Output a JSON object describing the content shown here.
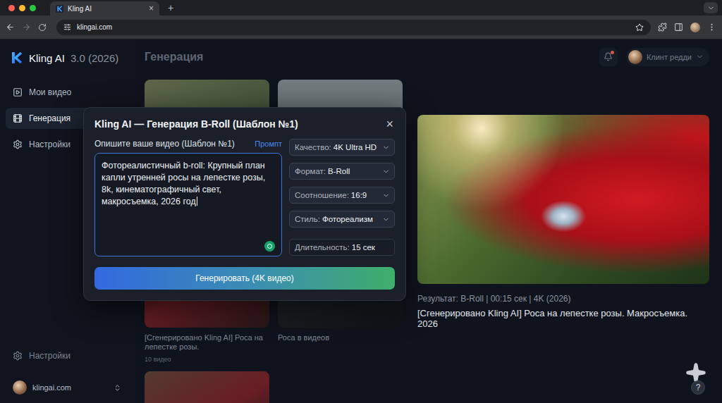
{
  "browser": {
    "tab": {
      "title": "Kling AI",
      "close": "×"
    },
    "new_tab": "+",
    "url": "klingai.com"
  },
  "sidebar": {
    "logo": {
      "name": "Kling AI",
      "version": "3.0 (2026)"
    },
    "items": [
      {
        "label": "Мои видео",
        "selected": false
      },
      {
        "label": "Генерация",
        "selected": true
      },
      {
        "label": "Настройки",
        "selected": false
      }
    ],
    "footer_item": "Настройки",
    "account": "klingai.com"
  },
  "header": {
    "title": "Генерация",
    "user": "Клинт редди"
  },
  "gallery": [
    {},
    {},
    {
      "title": "[Сгенерировано Kling AI] Роса на лепестке розы.",
      "meta": "10 видео"
    },
    {
      "title": "Роса в видеов"
    },
    {}
  ],
  "dialog": {
    "title": "Kling AI — Генерация B-Roll (Шаблон №1)",
    "close": "×",
    "prompt_label": "Опишите ваше видео (Шаблон №1)",
    "prompt_link": "Промпт",
    "prompt_text": "Фотореалистичный b-roll: Крупный план капли утренней росы на лепестке розы, 8k, кинематографичный свет, макросъемка, 2026 год",
    "options": [
      {
        "label": "Качество:",
        "value": "4K Ultra HD",
        "kind": "select"
      },
      {
        "label": "Формат:",
        "value": "B-Roll",
        "kind": "select"
      },
      {
        "label": "Соотношение:",
        "value": "16:9",
        "kind": "select"
      },
      {
        "label": "Стиль:",
        "value": "Фотореализм",
        "kind": "select"
      },
      {
        "label": "Длительность:",
        "value": "15 сек",
        "kind": "field"
      }
    ],
    "button": "Генерировать (4K видео)"
  },
  "result": {
    "meta": "Результат: B-Roll | 00:15 сек | 4K (2026)",
    "caption": "[Сгенерировано Kling AI] Роса на лепестке розы. Макросъемка. 2026"
  },
  "help": "?"
}
